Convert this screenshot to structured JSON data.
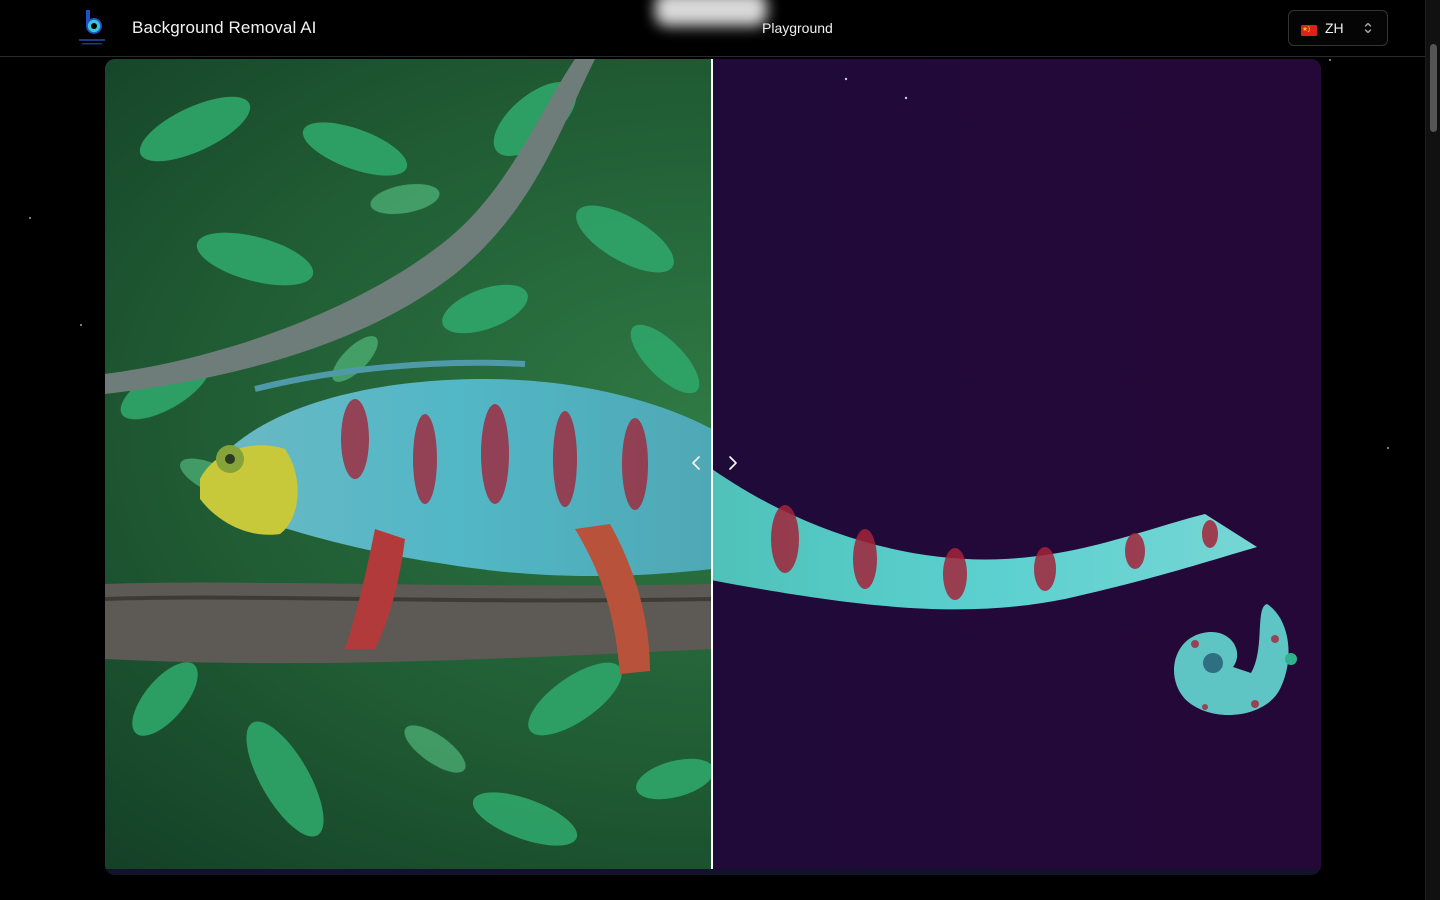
{
  "header": {
    "brand": "Background Removal AI",
    "nav": {
      "playground": "Playground"
    },
    "language": {
      "code": "ZH"
    }
  },
  "compare": {
    "divider_fraction": 0.5
  },
  "colors": {
    "page_bg": "#000000",
    "canvas_bg": "#1f0b3a",
    "accent_cyan": "#37c6d8",
    "accent_blue": "#1e50c8"
  },
  "icons": [
    "brand-logo-icon",
    "china-flag-icon",
    "chevron-up-down-icon",
    "chevron-left-icon",
    "chevron-right-icon"
  ]
}
